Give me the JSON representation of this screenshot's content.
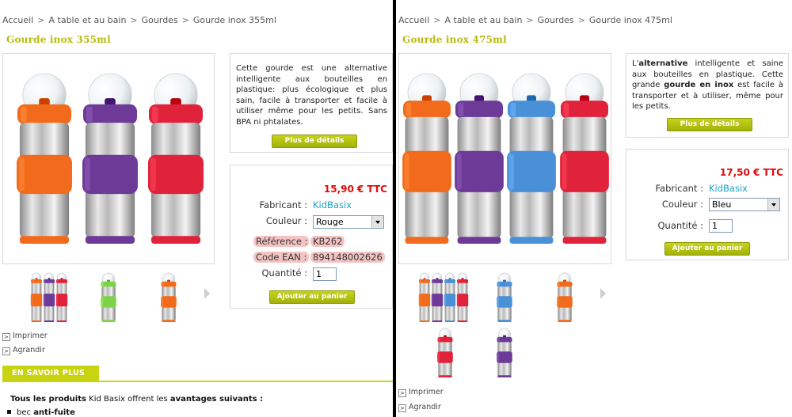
{
  "left": {
    "breadcrumb": [
      "Accueil",
      "A table et au bain",
      "Gourdes",
      "Gourde inox 355ml"
    ],
    "title": "Gourde inox 355ml",
    "description": [
      {
        "t": "Cette gourde est une alternative intelligente aux bouteilles en plastique: plus écologique et plus sain, facile à transporter et facile à utiliser même pour les petits. Sans BPA ni phtalates.",
        "b": false
      }
    ],
    "details_button": "Plus de détails",
    "price": "15,90 € TTC",
    "fabricant_label": "Fabricant :",
    "fabricant_value": "KidBasix",
    "couleur_label": "Couleur :",
    "couleur_value": "Rouge",
    "reference_label": "Référence :",
    "reference_value": "KB262",
    "ean_label": "Code EAN :",
    "ean_value": "894148002626",
    "quantite_label": "Quantité :",
    "quantite_value": "1",
    "cart_button": "Ajouter au panier",
    "imprimer": "Imprimer",
    "agrandir": "Agrandir",
    "savoir_plus": "EN SAVOIR PLUS",
    "tous_bold": "Tous les produits",
    "tous_mid": " Kid Basix offrent les ",
    "tous_bold2": "avantages suivants :",
    "bullet_pre": "bec ",
    "bullet_bold": "anti-fuite",
    "bottles": [
      "#f26a1b",
      "#6d3a98",
      "#e0233a"
    ],
    "thumbs": [
      {
        "colors": [
          "#f26a1b",
          "#6d3a98",
          "#e0233a"
        ]
      },
      {
        "colors": [
          "#7ed24a"
        ]
      },
      {
        "colors": [
          "#f26a1b"
        ]
      }
    ],
    "box_glyph": ">"
  },
  "right": {
    "breadcrumb": [
      "Accueil",
      "A table et au bain",
      "Gourdes",
      "Gourde inox 475ml"
    ],
    "title": "Gourde inox 475ml",
    "desc_parts": [
      {
        "t": "L'",
        "b": false
      },
      {
        "t": "alternative",
        "b": true
      },
      {
        "t": " intelligente et saine aux bouteilles en plastique. Cette grande ",
        "b": false
      },
      {
        "t": "gourde en inox",
        "b": true
      },
      {
        "t": " est facile à transporter et à utiliser, même pour les petits.",
        "b": false
      }
    ],
    "details_button": "Plus de détails",
    "price": "17,50 € TTC",
    "fabricant_label": "Fabricant :",
    "fabricant_value": "KidBasix",
    "couleur_label": "Couleur :",
    "couleur_value": "Bleu",
    "quantite_label": "Quantité :",
    "quantite_value": "1",
    "cart_button": "Ajouter au panier",
    "imprimer": "Imprimer",
    "agrandir": "Agrandir",
    "bottles": [
      "#f26a1b",
      "#6d3a98",
      "#4a90d9",
      "#e0233a"
    ],
    "thumbs": [
      {
        "colors": [
          "#f26a1b",
          "#6d3a98",
          "#4a90d9",
          "#e0233a"
        ]
      },
      {
        "colors": [
          "#4a90d9"
        ]
      },
      {
        "colors": [
          "#f26a1b"
        ]
      },
      {
        "colors": [
          "#e0233a"
        ]
      },
      {
        "colors": [
          "#6d3a98"
        ]
      }
    ],
    "box_glyph": ">"
  },
  "colors": {
    "accent_green": "#c8d311",
    "price_red": "#e00a0a",
    "link_blue": "#1aa4c8",
    "title_green": "#b8bb0c",
    "highlight": "#f4c4c4"
  }
}
